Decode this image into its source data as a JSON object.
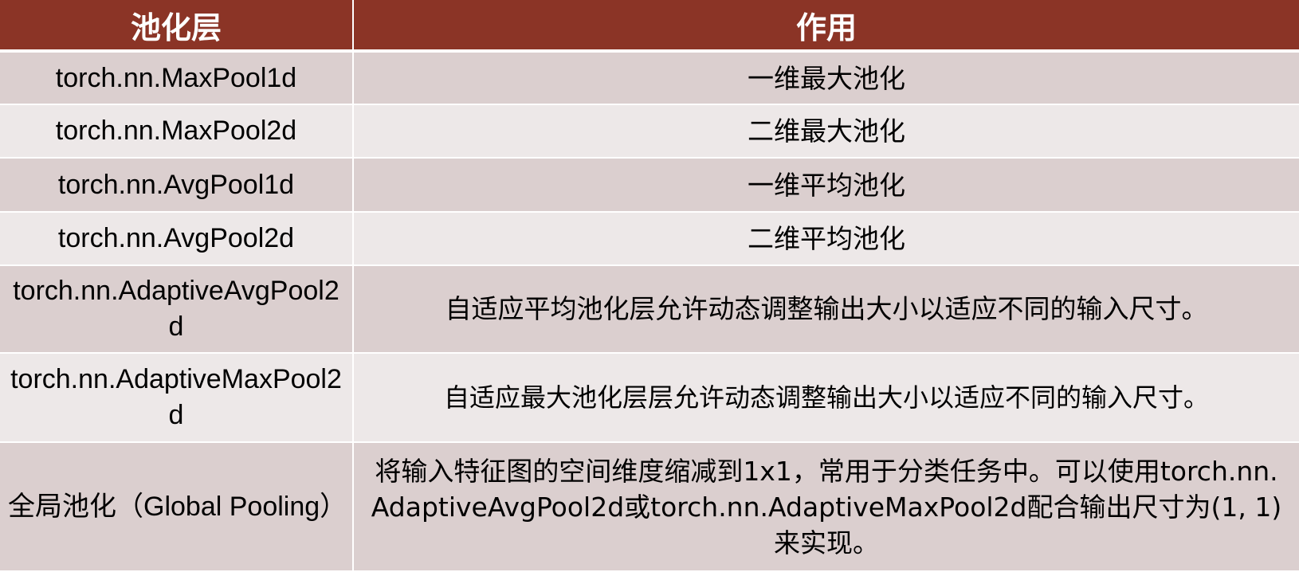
{
  "table": {
    "headers": [
      "池化层",
      "作用"
    ],
    "rows": [
      {
        "name": "torch.nn.MaxPool1d",
        "desc": "一维最大池化"
      },
      {
        "name": "torch.nn.MaxPool2d",
        "desc": "二维最大池化"
      },
      {
        "name": "torch.nn.AvgPool1d",
        "desc": "一维平均池化"
      },
      {
        "name": "torch.nn.AvgPool2d",
        "desc": "二维平均池化"
      },
      {
        "name": "torch.nn.AdaptiveAvgPool2d",
        "desc": "自适应平均池化层允许动态调整输出大小以适应不同的输入尺寸。"
      },
      {
        "name": "torch.nn.AdaptiveMaxPool2d",
        "desc": "自适应最大池化层层允许动态调整输出大小以适应不同的输入尺寸。"
      },
      {
        "name": "全局池化（Global Pooling）",
        "desc": "将输入特征图的空间维度缩减到1x1，常用于分类任务中。可以使用torch.nn.AdaptiveAvgPool2d或torch.nn.AdaptiveMaxPool2d配合输出尺寸为(1, 1)来实现。"
      }
    ]
  }
}
